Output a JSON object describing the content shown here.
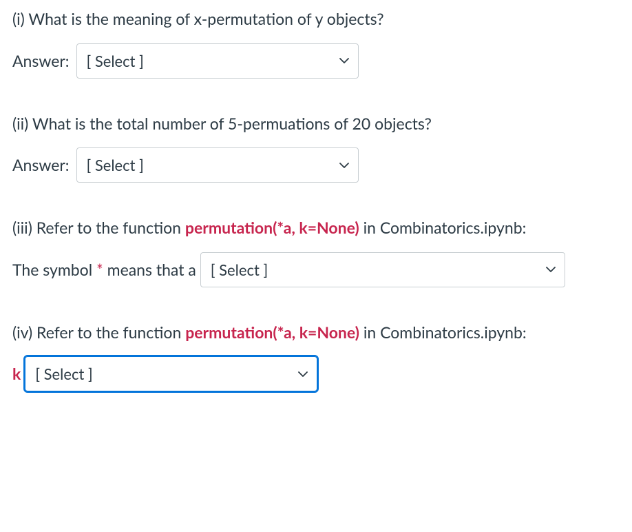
{
  "q1": {
    "prompt": "(i) What is the meaning of x-permutation of y objects?",
    "answerLabel": "Answer:",
    "selectPlaceholder": "[ Select ]"
  },
  "q2": {
    "prompt": "(ii) What is the total number of 5-permuations of 20 objects?",
    "answerLabel": "Answer:",
    "selectPlaceholder": "[ Select ]"
  },
  "q3": {
    "prefix": "(iii) Refer to the function ",
    "code": "permutation(*a, k=None)",
    "suffix": " in Combinatorics.ipynb:",
    "line2_part1": "The symbol ",
    "asterisk": "*",
    "line2_part2": " means that a",
    "selectPlaceholder": "[ Select ]"
  },
  "q4": {
    "prefix": "(iv) Refer to the function ",
    "code": "permutation(*a, k=None)",
    "suffix": " in Combinatorics.ipynb:",
    "k_label": "k",
    "selectPlaceholder": "[ Select ]"
  }
}
